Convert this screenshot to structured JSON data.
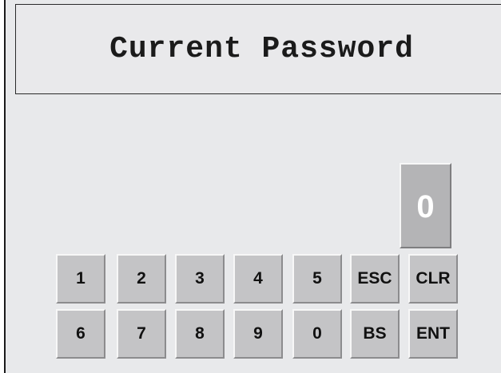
{
  "title": "Current Password",
  "display": {
    "value": "0"
  },
  "keypad": {
    "key_1": "1",
    "key_2": "2",
    "key_3": "3",
    "key_4": "4",
    "key_5": "5",
    "key_esc": "ESC",
    "key_clr": "CLR",
    "key_6": "6",
    "key_7": "7",
    "key_8": "8",
    "key_9": "9",
    "key_0": "0",
    "key_bs": "BS",
    "key_ent": "ENT"
  },
  "colors": {
    "background": "#e8e9eb",
    "key_face": "#c4c4c6",
    "display_face": "#b4b4b6",
    "display_text": "#ffffff",
    "text": "#111111"
  }
}
